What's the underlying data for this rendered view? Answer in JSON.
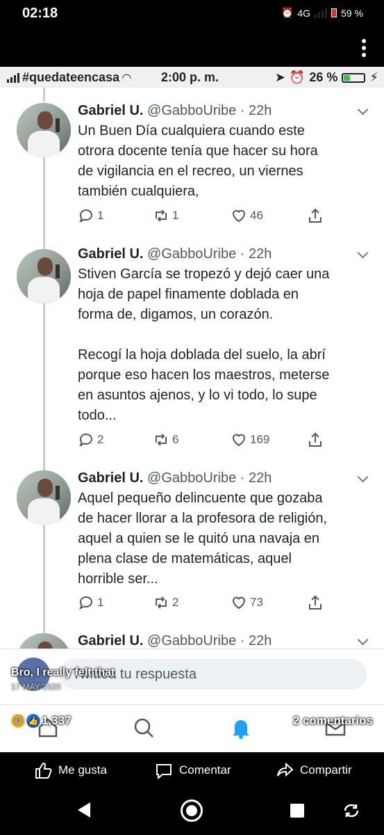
{
  "outer_status": {
    "time": "02:18",
    "network": "4G",
    "battery": "59 %"
  },
  "inner_status": {
    "carrier": "#quedateencasa",
    "time": "2:00 p. m.",
    "battery": "26 %"
  },
  "tweets": [
    {
      "name": "Gabriel U.",
      "handle": "@GabboUribe",
      "time": "· 22h",
      "lines": [
        "Un Buen Día cualquiera cuando este",
        "otrora docente tenía que hacer su hora",
        "de vigilancia en el recreo, un viernes",
        "también cualquiera,"
      ],
      "replies": "1",
      "retweets": "1",
      "likes": "46"
    },
    {
      "name": "Gabriel U.",
      "handle": "@GabboUribe",
      "time": "· 22h",
      "lines": [
        "Stiven García se tropezó y dejó caer una",
        "hoja de papel finamente doblada en",
        "forma de, digamos, un corazón.",
        "",
        "Recogí la hoja doblada del suelo, la abrí",
        "porque eso hacen los maestros, meterse",
        "en asuntos ajenos, y lo vi todo, lo supe",
        "todo..."
      ],
      "replies": "2",
      "retweets": "6",
      "likes": "169"
    },
    {
      "name": "Gabriel U.",
      "handle": "@GabboUribe",
      "time": "· 22h",
      "lines": [
        "Aquel pequeño delincuente que gozaba",
        "de hacer llorar a la profesora de religión,",
        "aquel a quien se le quitó una navaja en",
        "plena clase de matemáticas, aquel",
        "horrible ser..."
      ],
      "replies": "1",
      "retweets": "2",
      "likes": "73"
    },
    {
      "name": "Gabriel U.",
      "handle": "@GabboUribe",
      "time": "· 22h"
    }
  ],
  "reply_placeholder": "Twittea tu respuesta",
  "overlay": {
    "post_title": "Bro, I really felt that",
    "post_date": "17 MAY 2020",
    "reaction_count": "1,337",
    "comments": "2 comentarios"
  },
  "fb_actions": {
    "like": "Me gusta",
    "comment": "Comentar",
    "share": "Compartir"
  },
  "colors": {
    "twitter_text": "#1c2126",
    "twitter_muted": "#4d5860",
    "notification_blue": "#1da1f2",
    "battery_green": "#3ac24a"
  }
}
